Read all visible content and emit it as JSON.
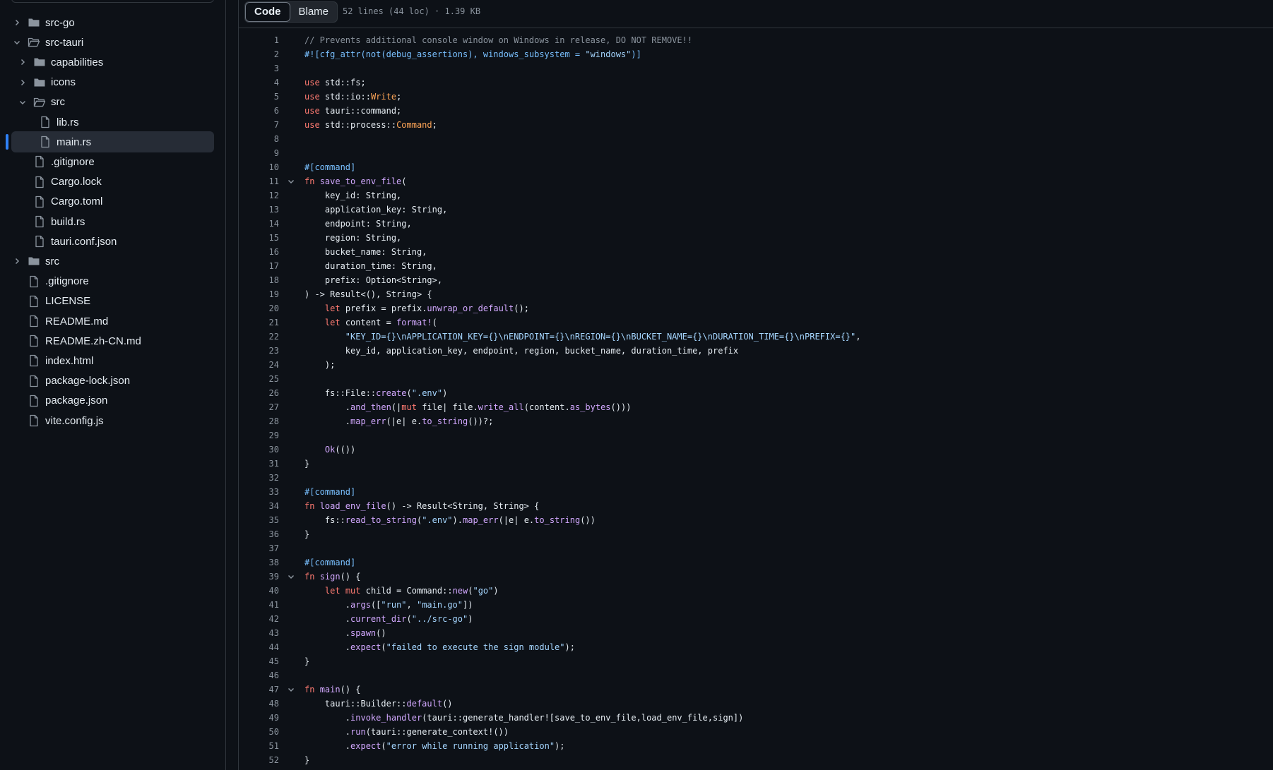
{
  "sidebar": {
    "items": [
      {
        "label": "src-go",
        "type": "folder",
        "expanded": false,
        "depth": 0
      },
      {
        "label": "src-tauri",
        "type": "folder",
        "expanded": true,
        "depth": 0
      },
      {
        "label": "capabilities",
        "type": "folder",
        "expanded": false,
        "depth": 1
      },
      {
        "label": "icons",
        "type": "folder",
        "expanded": false,
        "depth": 1
      },
      {
        "label": "src",
        "type": "folder",
        "expanded": true,
        "depth": 1
      },
      {
        "label": "lib.rs",
        "type": "file",
        "depth": 2
      },
      {
        "label": "main.rs",
        "type": "file",
        "depth": 2,
        "selected": true
      },
      {
        "label": ".gitignore",
        "type": "file",
        "depth": 1
      },
      {
        "label": "Cargo.lock",
        "type": "file",
        "depth": 1
      },
      {
        "label": "Cargo.toml",
        "type": "file",
        "depth": 1
      },
      {
        "label": "build.rs",
        "type": "file",
        "depth": 1
      },
      {
        "label": "tauri.conf.json",
        "type": "file",
        "depth": 1
      },
      {
        "label": "src",
        "type": "folder",
        "expanded": false,
        "depth": 0
      },
      {
        "label": ".gitignore",
        "type": "file",
        "depth": 0
      },
      {
        "label": "LICENSE",
        "type": "file",
        "depth": 0
      },
      {
        "label": "README.md",
        "type": "file",
        "depth": 0
      },
      {
        "label": "README.zh-CN.md",
        "type": "file",
        "depth": 0
      },
      {
        "label": "index.html",
        "type": "file",
        "depth": 0
      },
      {
        "label": "package-lock.json",
        "type": "file",
        "depth": 0
      },
      {
        "label": "package.json",
        "type": "file",
        "depth": 0
      },
      {
        "label": "vite.config.js",
        "type": "file",
        "depth": 0
      }
    ]
  },
  "header": {
    "code_label": "Code",
    "blame_label": "Blame",
    "file_meta": "52 lines (44 loc) · 1.39 KB"
  },
  "colors": {
    "comment": "#8b949e",
    "keyword": "#ff7b72",
    "string": "#a5d6ff",
    "function": "#d2a8ff",
    "type": "#ffa657",
    "attribute": "#79c0ff",
    "accent": "#2f81f7"
  },
  "code": {
    "lines": [
      {
        "n": "1",
        "foldable": false,
        "tokens": [
          [
            "com",
            "// Prevents additional console window on Windows in release, DO NOT REMOVE!!"
          ]
        ]
      },
      {
        "n": "2",
        "foldable": false,
        "tokens": [
          [
            "attr",
            "#![cfg_attr(not(debug_assertions), windows_subsystem = "
          ],
          [
            "str",
            "\"windows\""
          ],
          [
            "attr",
            ")]"
          ]
        ]
      },
      {
        "n": "3",
        "foldable": false,
        "tokens": []
      },
      {
        "n": "4",
        "foldable": false,
        "tokens": [
          [
            "kw",
            "use"
          ],
          [
            "p",
            " std::fs;"
          ]
        ]
      },
      {
        "n": "5",
        "foldable": false,
        "tokens": [
          [
            "kw",
            "use"
          ],
          [
            "p",
            " std::io::"
          ],
          [
            "ty",
            "Write"
          ],
          [
            "p",
            ";"
          ]
        ]
      },
      {
        "n": "6",
        "foldable": false,
        "tokens": [
          [
            "kw",
            "use"
          ],
          [
            "p",
            " tauri::command;"
          ]
        ]
      },
      {
        "n": "7",
        "foldable": false,
        "tokens": [
          [
            "kw",
            "use"
          ],
          [
            "p",
            " std::process::"
          ],
          [
            "ty",
            "Command"
          ],
          [
            "p",
            ";"
          ]
        ]
      },
      {
        "n": "8",
        "foldable": false,
        "tokens": []
      },
      {
        "n": "9",
        "foldable": false,
        "tokens": []
      },
      {
        "n": "10",
        "foldable": false,
        "tokens": [
          [
            "attr",
            "#[command]"
          ]
        ]
      },
      {
        "n": "11",
        "foldable": true,
        "tokens": [
          [
            "kw",
            "fn"
          ],
          [
            "p",
            " "
          ],
          [
            "fn",
            "save_to_env_file"
          ],
          [
            "p",
            "("
          ]
        ]
      },
      {
        "n": "12",
        "foldable": false,
        "tokens": [
          [
            "p",
            "    key_id: String,"
          ]
        ]
      },
      {
        "n": "13",
        "foldable": false,
        "tokens": [
          [
            "p",
            "    application_key: String,"
          ]
        ]
      },
      {
        "n": "14",
        "foldable": false,
        "tokens": [
          [
            "p",
            "    endpoint: String,"
          ]
        ]
      },
      {
        "n": "15",
        "foldable": false,
        "tokens": [
          [
            "p",
            "    region: String,"
          ]
        ]
      },
      {
        "n": "16",
        "foldable": false,
        "tokens": [
          [
            "p",
            "    bucket_name: String,"
          ]
        ]
      },
      {
        "n": "17",
        "foldable": false,
        "tokens": [
          [
            "p",
            "    duration_time: String,"
          ]
        ]
      },
      {
        "n": "18",
        "foldable": false,
        "tokens": [
          [
            "p",
            "    prefix: Option<String>,"
          ]
        ]
      },
      {
        "n": "19",
        "foldable": false,
        "tokens": [
          [
            "p",
            ") -> Result<(), String> {"
          ]
        ]
      },
      {
        "n": "20",
        "foldable": false,
        "tokens": [
          [
            "p",
            "    "
          ],
          [
            "kw",
            "let"
          ],
          [
            "p",
            " prefix = prefix."
          ],
          [
            "fn",
            "unwrap_or_default"
          ],
          [
            "p",
            "();"
          ]
        ]
      },
      {
        "n": "21",
        "foldable": false,
        "tokens": [
          [
            "p",
            "    "
          ],
          [
            "kw",
            "let"
          ],
          [
            "p",
            " content = "
          ],
          [
            "fn",
            "format!"
          ],
          [
            "p",
            "("
          ]
        ]
      },
      {
        "n": "22",
        "foldable": false,
        "tokens": [
          [
            "p",
            "        "
          ],
          [
            "str",
            "\"KEY_ID={}\\nAPPLICATION_KEY={}\\nENDPOINT={}\\nREGION={}\\nBUCKET_NAME={}\\nDURATION_TIME={}\\nPREFIX={}\""
          ],
          [
            "p",
            ","
          ]
        ]
      },
      {
        "n": "23",
        "foldable": false,
        "tokens": [
          [
            "p",
            "        key_id, application_key, endpoint, region, bucket_name, duration_time, prefix"
          ]
        ]
      },
      {
        "n": "24",
        "foldable": false,
        "tokens": [
          [
            "p",
            "    );"
          ]
        ]
      },
      {
        "n": "25",
        "foldable": false,
        "tokens": []
      },
      {
        "n": "26",
        "foldable": false,
        "tokens": [
          [
            "p",
            "    fs::File::"
          ],
          [
            "fn",
            "create"
          ],
          [
            "p",
            "("
          ],
          [
            "str",
            "\".env\""
          ],
          [
            "p",
            ")"
          ]
        ]
      },
      {
        "n": "27",
        "foldable": false,
        "tokens": [
          [
            "p",
            "        ."
          ],
          [
            "fn",
            "and_then"
          ],
          [
            "p",
            "(|"
          ],
          [
            "kw",
            "mut"
          ],
          [
            "p",
            " file| file."
          ],
          [
            "fn",
            "write_all"
          ],
          [
            "p",
            "(content."
          ],
          [
            "fn",
            "as_bytes"
          ],
          [
            "p",
            "()))"
          ]
        ]
      },
      {
        "n": "28",
        "foldable": false,
        "tokens": [
          [
            "p",
            "        ."
          ],
          [
            "fn",
            "map_err"
          ],
          [
            "p",
            "(|e| e."
          ],
          [
            "fn",
            "to_string"
          ],
          [
            "p",
            "())?;"
          ]
        ]
      },
      {
        "n": "29",
        "foldable": false,
        "tokens": []
      },
      {
        "n": "30",
        "foldable": false,
        "tokens": [
          [
            "p",
            "    "
          ],
          [
            "fn",
            "Ok"
          ],
          [
            "p",
            "(())"
          ]
        ]
      },
      {
        "n": "31",
        "foldable": false,
        "tokens": [
          [
            "p",
            "}"
          ]
        ]
      },
      {
        "n": "32",
        "foldable": false,
        "tokens": []
      },
      {
        "n": "33",
        "foldable": false,
        "tokens": [
          [
            "attr",
            "#[command]"
          ]
        ]
      },
      {
        "n": "34",
        "foldable": false,
        "tokens": [
          [
            "kw",
            "fn"
          ],
          [
            "p",
            " "
          ],
          [
            "fn",
            "load_env_file"
          ],
          [
            "p",
            "() -> Result<String, String> {"
          ]
        ]
      },
      {
        "n": "35",
        "foldable": false,
        "tokens": [
          [
            "p",
            "    fs::"
          ],
          [
            "fn",
            "read_to_string"
          ],
          [
            "p",
            "("
          ],
          [
            "str",
            "\".env\""
          ],
          [
            "p",
            ")."
          ],
          [
            "fn",
            "map_err"
          ],
          [
            "p",
            "(|e| e."
          ],
          [
            "fn",
            "to_string"
          ],
          [
            "p",
            "())"
          ]
        ]
      },
      {
        "n": "36",
        "foldable": false,
        "tokens": [
          [
            "p",
            "}"
          ]
        ]
      },
      {
        "n": "37",
        "foldable": false,
        "tokens": []
      },
      {
        "n": "38",
        "foldable": false,
        "tokens": [
          [
            "attr",
            "#[command]"
          ]
        ]
      },
      {
        "n": "39",
        "foldable": true,
        "tokens": [
          [
            "kw",
            "fn"
          ],
          [
            "p",
            " "
          ],
          [
            "fn",
            "sign"
          ],
          [
            "p",
            "() {"
          ]
        ]
      },
      {
        "n": "40",
        "foldable": false,
        "tokens": [
          [
            "p",
            "    "
          ],
          [
            "kw",
            "let"
          ],
          [
            "p",
            " "
          ],
          [
            "kw",
            "mut"
          ],
          [
            "p",
            " child = Command::"
          ],
          [
            "fn",
            "new"
          ],
          [
            "p",
            "("
          ],
          [
            "str",
            "\"go\""
          ],
          [
            "p",
            ")"
          ]
        ]
      },
      {
        "n": "41",
        "foldable": false,
        "tokens": [
          [
            "p",
            "        ."
          ],
          [
            "fn",
            "args"
          ],
          [
            "p",
            "(["
          ],
          [
            "str",
            "\"run\""
          ],
          [
            "p",
            ", "
          ],
          [
            "str",
            "\"main.go\""
          ],
          [
            "p",
            "])"
          ]
        ]
      },
      {
        "n": "42",
        "foldable": false,
        "tokens": [
          [
            "p",
            "        ."
          ],
          [
            "fn",
            "current_dir"
          ],
          [
            "p",
            "("
          ],
          [
            "str",
            "\"../src-go\""
          ],
          [
            "p",
            ")"
          ]
        ]
      },
      {
        "n": "43",
        "foldable": false,
        "tokens": [
          [
            "p",
            "        ."
          ],
          [
            "fn",
            "spawn"
          ],
          [
            "p",
            "()"
          ]
        ]
      },
      {
        "n": "44",
        "foldable": false,
        "tokens": [
          [
            "p",
            "        ."
          ],
          [
            "fn",
            "expect"
          ],
          [
            "p",
            "("
          ],
          [
            "str",
            "\"failed to execute the sign module\""
          ],
          [
            "p",
            ");"
          ]
        ]
      },
      {
        "n": "45",
        "foldable": false,
        "tokens": [
          [
            "p",
            "}"
          ]
        ]
      },
      {
        "n": "46",
        "foldable": false,
        "tokens": []
      },
      {
        "n": "47",
        "foldable": true,
        "tokens": [
          [
            "kw",
            "fn"
          ],
          [
            "p",
            " "
          ],
          [
            "fn",
            "main"
          ],
          [
            "p",
            "() {"
          ]
        ]
      },
      {
        "n": "48",
        "foldable": false,
        "tokens": [
          [
            "p",
            "    tauri::Builder::"
          ],
          [
            "fn",
            "default"
          ],
          [
            "p",
            "()"
          ]
        ]
      },
      {
        "n": "49",
        "foldable": false,
        "tokens": [
          [
            "p",
            "        ."
          ],
          [
            "fn",
            "invoke_handler"
          ],
          [
            "p",
            "(tauri::generate_handler![save_to_env_file,load_env_file,sign])"
          ]
        ]
      },
      {
        "n": "50",
        "foldable": false,
        "tokens": [
          [
            "p",
            "        ."
          ],
          [
            "fn",
            "run"
          ],
          [
            "p",
            "(tauri::generate_context!())"
          ]
        ]
      },
      {
        "n": "51",
        "foldable": false,
        "tokens": [
          [
            "p",
            "        ."
          ],
          [
            "fn",
            "expect"
          ],
          [
            "p",
            "("
          ],
          [
            "str",
            "\"error while running application\""
          ],
          [
            "p",
            ");"
          ]
        ]
      },
      {
        "n": "52",
        "foldable": false,
        "tokens": [
          [
            "p",
            "}"
          ]
        ]
      }
    ]
  }
}
